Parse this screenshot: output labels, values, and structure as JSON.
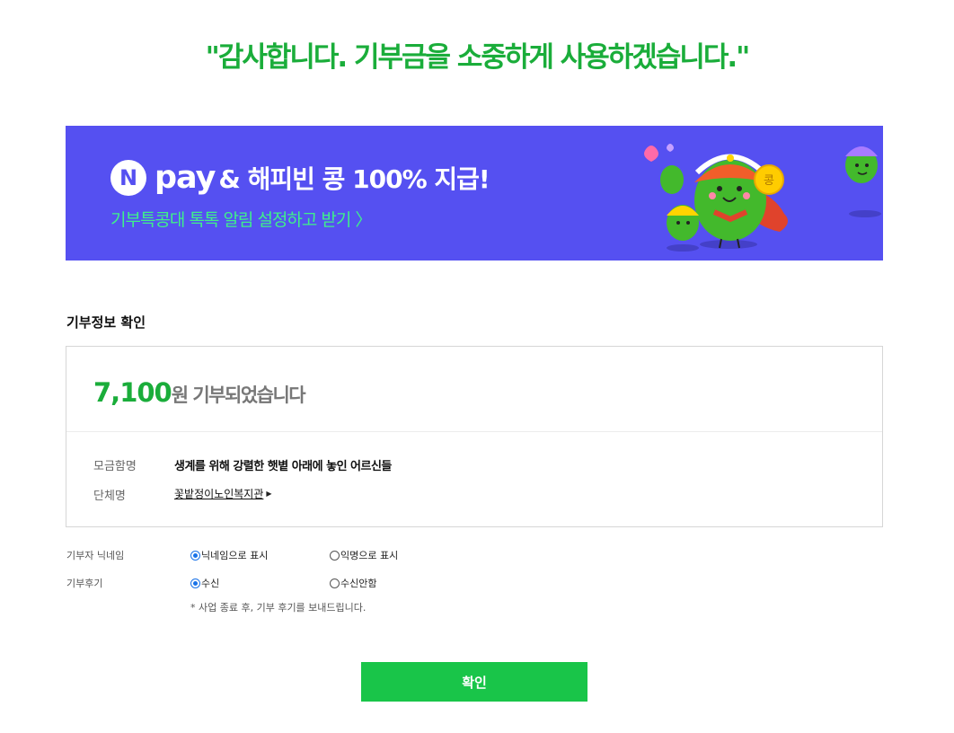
{
  "headline": "\"감사합니다. 기부금을 소중하게 사용하겠습니다.\"",
  "banner": {
    "n_badge": "N",
    "pay_word": "pay",
    "title": "& 해피빈 콩 100% 지급!",
    "subtitle": "기부특콩대 톡톡 알림 설정하고 받기 〉"
  },
  "section_title": "기부정보 확인",
  "donation": {
    "amount": "7,100",
    "amount_suffix": "원 기부되었습니다",
    "campaign_label": "모금함명",
    "campaign_value": "생계를 위해 강렬한 햇볕 아래에 놓인 어르신들",
    "org_label": "단체명",
    "org_value": "꽃밭정이노인복지관",
    "org_arrow": "▶"
  },
  "options": {
    "nickname": {
      "label": "기부자 닉네임",
      "choices": [
        "닉네임으로 표시",
        "익명으로 표시"
      ],
      "selected": 0
    },
    "review": {
      "label": "기부후기",
      "choices": [
        "수신",
        "수신안함"
      ],
      "selected": 0
    },
    "note": "* 사업 종료 후, 기부 후기를 보내드립니다."
  },
  "confirm_label": "확인",
  "colors": {
    "accent_green": "#1aad3a",
    "button_green": "#19c549",
    "banner_bg": "#5550f1",
    "banner_sub": "#3ff08a"
  }
}
